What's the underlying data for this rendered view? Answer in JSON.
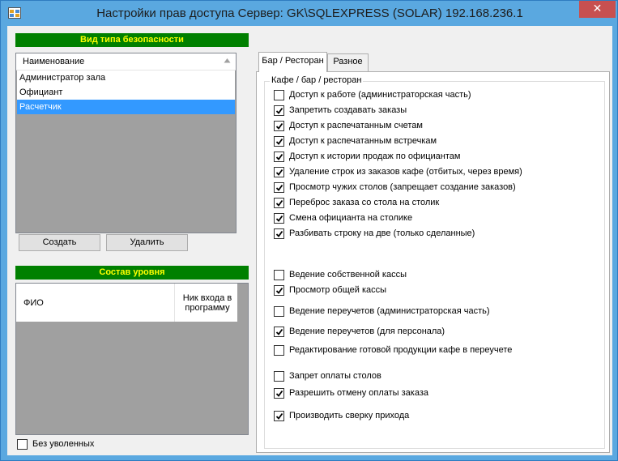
{
  "window": {
    "title": "Настройки прав доступа  Сервер: GK\\SQLEXPRESS (SOLAR) 192.168.236.1",
    "close_label": "✕"
  },
  "left_panel": {
    "security_type_header": "Вид типа безопасности",
    "roles_list": {
      "column_header": "Наименование",
      "items": [
        {
          "label": "Администратор зала",
          "selected": false
        },
        {
          "label": "Официант",
          "selected": false
        },
        {
          "label": "Расчетчик",
          "selected": true
        }
      ]
    },
    "create_button": "Создать",
    "delete_button": "Удалить",
    "level_header": "Состав уровня",
    "members_list": {
      "columns": [
        "ФИО",
        "Ник входа в программу"
      ]
    },
    "without_fired": {
      "label": "Без уволенных",
      "checked": false
    }
  },
  "tabs": [
    {
      "label": "Бар / Ресторан",
      "active": true
    },
    {
      "label": "Разное",
      "active": false
    }
  ],
  "group": {
    "label": "Кафе / бар / ресторан",
    "permissions": [
      {
        "label": "Доступ к работе (администраторская часть)",
        "checked": false
      },
      {
        "label": "Запретить создавать заказы",
        "checked": true
      },
      {
        "label": "Доступ к распечатанным счетам",
        "checked": true
      },
      {
        "label": "Доступ к распечатанным встречкам",
        "checked": true
      },
      {
        "label": "Доступ к истории продаж по официантам",
        "checked": true
      },
      {
        "label": "Удаление строк из заказов кафе (отбитых, через время)",
        "checked": true
      },
      {
        "label": "Просмотр чужих столов (запрещает создание заказов)",
        "checked": true
      },
      {
        "label": "Переброс заказа со стола на столик",
        "checked": true
      },
      {
        "label": "Смена официанта на столике",
        "checked": true
      },
      {
        "label": "Разбивать строку на две (только сделанные)",
        "checked": true
      },
      {
        "label": "Ведение собственной кассы",
        "checked": false
      },
      {
        "label": "Просмотр общей кассы",
        "checked": true
      },
      {
        "label": "Ведение переучетов (администраторская часть)",
        "checked": false
      },
      {
        "label": "Ведение переучетов (для персонала)",
        "checked": true
      },
      {
        "label": "Редактирование готовой продукции кафе в переучете",
        "checked": false
      },
      {
        "label": "Запрет оплаты столов",
        "checked": false
      },
      {
        "label": "Разрешить отмену оплаты заказа",
        "checked": true
      },
      {
        "label": "Производить сверку прихода",
        "checked": true
      }
    ]
  },
  "colors": {
    "header_green": "#008000",
    "header_text": "#ffff00",
    "selection": "#3399ff",
    "frame": "#5aa8e0"
  }
}
